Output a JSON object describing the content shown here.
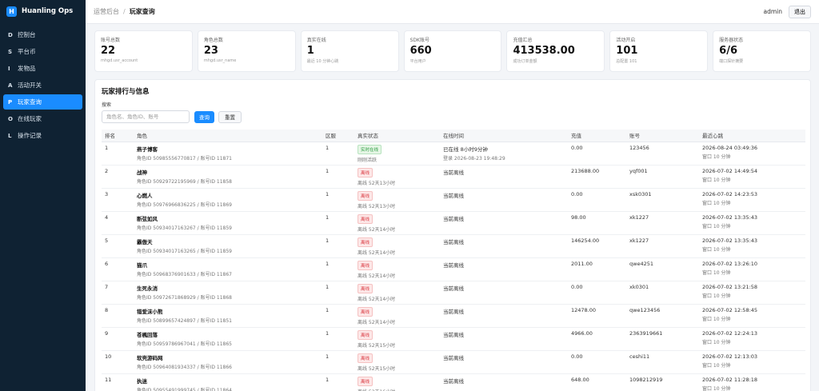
{
  "app": {
    "brand_letter": "H",
    "brand_name": "Huanling Ops"
  },
  "sidebar": {
    "items": [
      {
        "key": "D",
        "label": "控制台"
      },
      {
        "key": "S",
        "label": "平台币"
      },
      {
        "key": "I",
        "label": "发物品"
      },
      {
        "key": "A",
        "label": "活动开关"
      },
      {
        "key": "P",
        "label": "玩家查询"
      },
      {
        "key": "O",
        "label": "在线玩家"
      },
      {
        "key": "L",
        "label": "操作记录"
      }
    ]
  },
  "topbar": {
    "breadcrumb_root": "运营后台",
    "breadcrumb_sep": "/",
    "breadcrumb_current": "玩家查询",
    "user": "admin",
    "logout_label": "退出"
  },
  "cards": [
    {
      "label": "账号总数",
      "value": "22",
      "sub": "mhgd.usr_account"
    },
    {
      "label": "角色总数",
      "value": "23",
      "sub": "mhgd.usr_name"
    },
    {
      "label": "真实在线",
      "value": "1",
      "sub": "最近 10 分钟心跳"
    },
    {
      "label": "SDK账号",
      "value": "660",
      "sub": "平台用户"
    },
    {
      "label": "充值汇总",
      "value": "413538.00",
      "sub": "成功订单金额"
    },
    {
      "label": "活动开启",
      "value": "101",
      "sub": "总配置 101"
    },
    {
      "label": "服务器状态",
      "value": "6/6",
      "sub": "端口探针摘要"
    }
  ],
  "panel": {
    "title": "玩家排行与信息",
    "search_label": "搜索",
    "search_placeholder": "角色名、角色ID、账号",
    "search_value": "",
    "query_label": "查询",
    "reset_label": "重置"
  },
  "table": {
    "headers": [
      "排名",
      "角色",
      "区服",
      "真实状态",
      "在线时间",
      "充值",
      "账号",
      "最近心跳"
    ],
    "rows": [
      {
        "rank": "1",
        "name": "燕子博客",
        "ids": "角色ID 50985556770817 / 账号ID 11871",
        "server": "1",
        "status": "实时在线",
        "status_type": "online",
        "status_sub": "刚刚活跃",
        "online": "已在线 8小时9分钟",
        "online_sub": "登录 2026-08-23 19:48:29",
        "recharge": "0.00",
        "account": "123456",
        "heartbeat": "2026-08-24 03:49:36",
        "heartbeat_sub": "窗口 10 分钟"
      },
      {
        "rank": "2",
        "name": "战神",
        "ids": "角色ID 50929722195969 / 账号ID 11858",
        "server": "1",
        "status": "离线",
        "status_type": "offline",
        "status_sub": "离线 52天13小时",
        "online": "当前离线",
        "online_sub": "",
        "recharge": "213688.00",
        "account": "yqf001",
        "heartbeat": "2026-07-02 14:49:54",
        "heartbeat_sub": "窗口 10 分钟"
      },
      {
        "rank": "3",
        "name": "心燃人",
        "ids": "角色ID 50976966836225 / 账号ID 11869",
        "server": "1",
        "status": "离线",
        "status_type": "offline",
        "status_sub": "离线 52天13小时",
        "online": "当前离线",
        "online_sub": "",
        "recharge": "0.00",
        "account": "xsk0301",
        "heartbeat": "2026-07-02 14:23:53",
        "heartbeat_sub": "窗口 10 分钟"
      },
      {
        "rank": "4",
        "name": "断弦如风",
        "ids": "角色ID 50934017163267 / 账号ID 11859",
        "server": "1",
        "status": "离线",
        "status_type": "offline",
        "status_sub": "离线 52天14小时",
        "online": "当前离线",
        "online_sub": "",
        "recharge": "98.00",
        "account": "xk1227",
        "heartbeat": "2026-07-02 13:35:43",
        "heartbeat_sub": "窗口 10 分钟"
      },
      {
        "rank": "5",
        "name": "霸傲天",
        "ids": "角色ID 50934017163265 / 账号ID 11859",
        "server": "1",
        "status": "离线",
        "status_type": "offline",
        "status_sub": "离线 52天14小时",
        "online": "当前离线",
        "online_sub": "",
        "recharge": "146254.00",
        "account": "xk1227",
        "heartbeat": "2026-07-02 13:35:43",
        "heartbeat_sub": "窗口 10 分钟"
      },
      {
        "rank": "6",
        "name": "猫爪",
        "ids": "角色ID 50968376901633 / 账号ID 11867",
        "server": "1",
        "status": "离线",
        "status_type": "offline",
        "status_sub": "离线 52天14小时",
        "online": "当前离线",
        "online_sub": "",
        "recharge": "2011.00",
        "account": "qwe4251",
        "heartbeat": "2026-07-02 13:26:10",
        "heartbeat_sub": "窗口 10 分钟"
      },
      {
        "rank": "7",
        "name": "生死永消",
        "ids": "角色ID 50972671868929 / 账号ID 11868",
        "server": "1",
        "status": "离线",
        "status_type": "offline",
        "status_sub": "离线 52天14小时",
        "online": "当前离线",
        "online_sub": "",
        "recharge": "0.00",
        "account": "xk0301",
        "heartbeat": "2026-07-02 13:21:58",
        "heartbeat_sub": "窗口 10 分钟"
      },
      {
        "rank": "8",
        "name": "错爱沫小熊",
        "ids": "角色ID 50899657424897 / 账号ID 11851",
        "server": "1",
        "status": "离线",
        "status_type": "offline",
        "status_sub": "离线 52天14小时",
        "online": "当前离线",
        "online_sub": "",
        "recharge": "12478.00",
        "account": "qwe123456",
        "heartbeat": "2026-07-02 12:58:45",
        "heartbeat_sub": "窗口 10 分钟"
      },
      {
        "rank": "9",
        "name": "苍楓回落",
        "ids": "角色ID 50959786967041 / 账号ID 11865",
        "server": "1",
        "status": "离线",
        "status_type": "offline",
        "status_sub": "离线 52天15小时",
        "online": "当前离线",
        "online_sub": "",
        "recharge": "4966.00",
        "account": "2363919661",
        "heartbeat": "2026-07-02 12:24:13",
        "heartbeat_sub": "窗口 10 分钟"
      },
      {
        "rank": "10",
        "name": "软壳游码网",
        "ids": "角色ID 50964081934337 / 账号ID 11866",
        "server": "1",
        "status": "离线",
        "status_type": "offline",
        "status_sub": "离线 52天15小时",
        "online": "当前离线",
        "online_sub": "",
        "recharge": "0.00",
        "account": "ceshi11",
        "heartbeat": "2026-07-02 12:13:03",
        "heartbeat_sub": "窗口 10 分钟"
      },
      {
        "rank": "11",
        "name": "执迷",
        "ids": "角色ID 50955491999745 / 账号ID 11864",
        "server": "1",
        "status": "离线",
        "status_type": "offline",
        "status_sub": "离线 52天16小时",
        "online": "当前离线",
        "online_sub": "",
        "recharge": "648.00",
        "account": "1098212919",
        "heartbeat": "2026-07-02 11:28:18",
        "heartbeat_sub": "窗口 10 分钟"
      }
    ]
  },
  "colors": {
    "sidebar_bg": "#0f2233",
    "accent": "#1a8cff",
    "online": "#2f9e44",
    "offline": "#d9363e"
  }
}
